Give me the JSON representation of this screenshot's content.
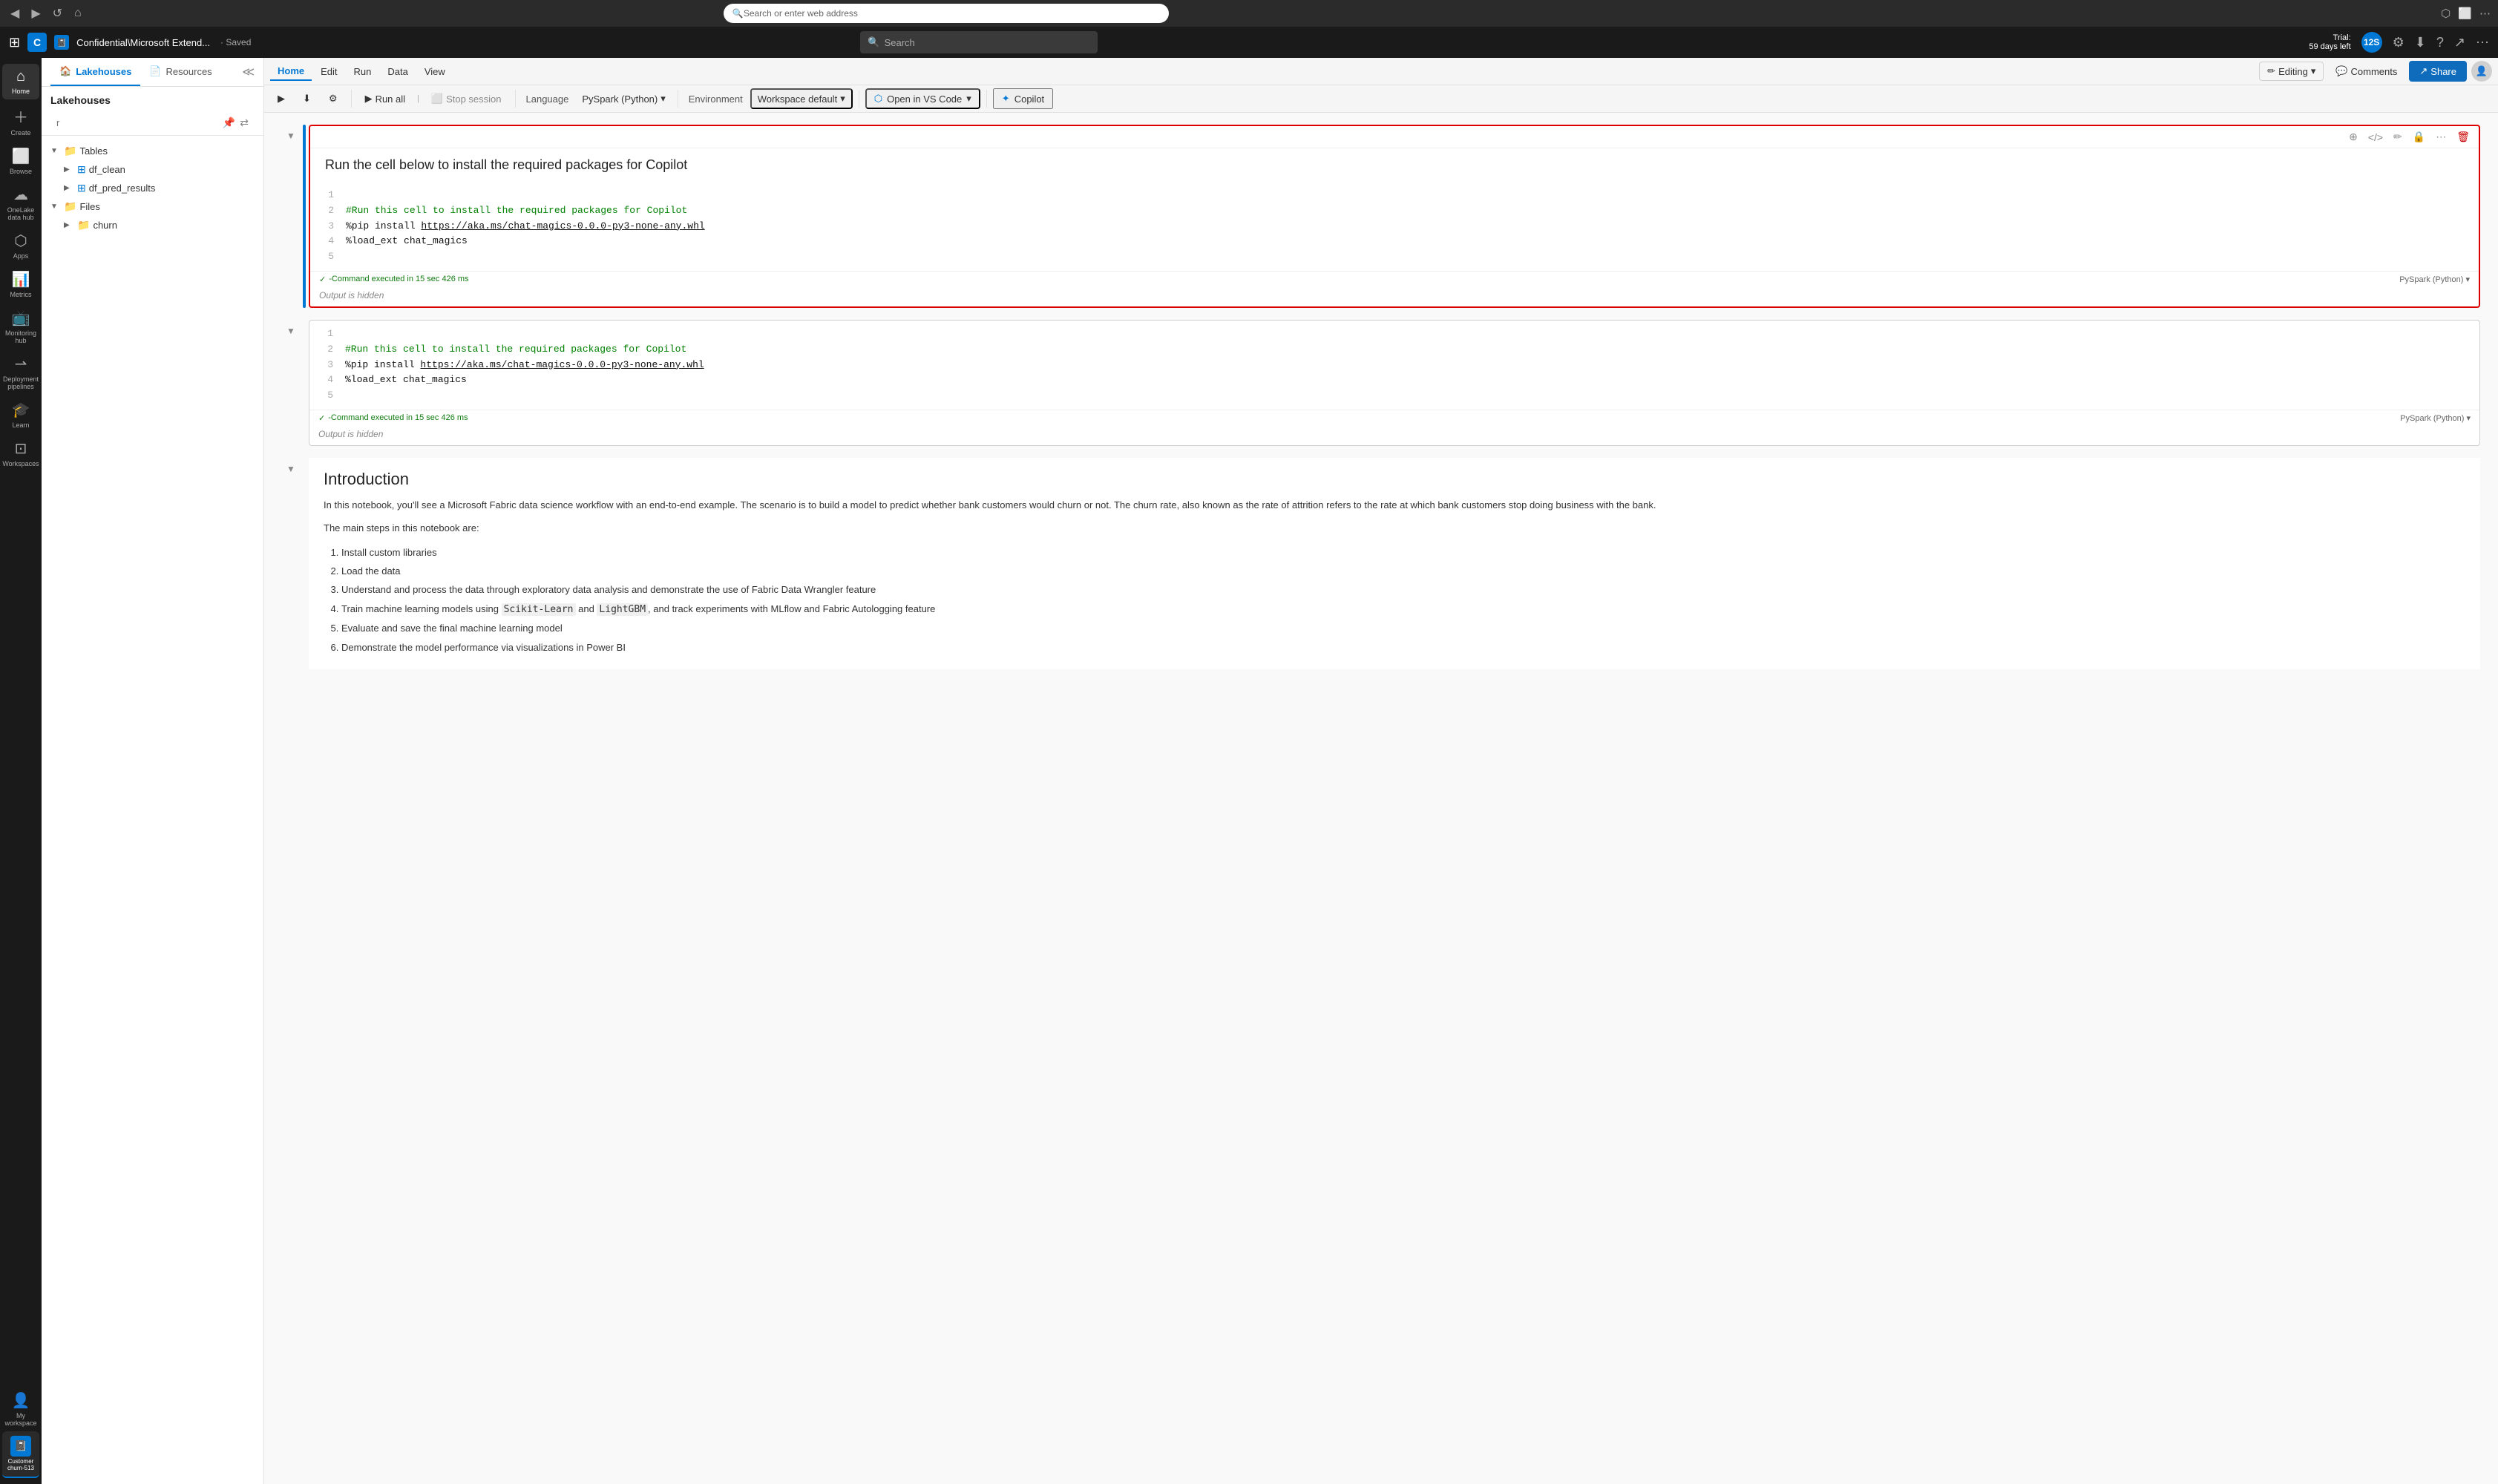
{
  "browser": {
    "address": "Search or enter web address",
    "nav_back": "◀",
    "nav_forward": "▶",
    "nav_refresh": "↺",
    "nav_home": "⌂"
  },
  "titlebar": {
    "app_letter": "C",
    "app_file_icon": "📓",
    "app_name": "Confidential\\Microsoft Extend...",
    "saved_label": "· Saved",
    "search_placeholder": "Search",
    "trial_line1": "Trial:",
    "trial_line2": "59 days left",
    "user_initials": "12S"
  },
  "sidebar": {
    "items": [
      {
        "id": "home",
        "label": "Home",
        "icon": "⌂"
      },
      {
        "id": "create",
        "label": "Create",
        "icon": "+"
      },
      {
        "id": "browse",
        "label": "Browse",
        "icon": "⊞"
      },
      {
        "id": "onelake",
        "label": "OneLake\ndata hub",
        "icon": "☁"
      },
      {
        "id": "apps",
        "label": "Apps",
        "icon": "⬡"
      },
      {
        "id": "metrics",
        "label": "Metrics",
        "icon": "📊"
      },
      {
        "id": "monitoring",
        "label": "Monitoring\nhub",
        "icon": "📺"
      },
      {
        "id": "deployment",
        "label": "Deployment\npipelines",
        "icon": "⇀"
      },
      {
        "id": "learn",
        "label": "Learn",
        "icon": "🎓"
      },
      {
        "id": "workspaces",
        "label": "Workspaces",
        "icon": "⊡"
      }
    ],
    "bottom": {
      "workspace_label": "My\nworkspace",
      "customer_label": "Customer\nchurn-513"
    }
  },
  "left_panel": {
    "tabs": [
      {
        "id": "lakehouses",
        "label": "Lakehouses",
        "icon": "🏠",
        "active": true
      },
      {
        "id": "resources",
        "label": "Resources",
        "icon": "📄"
      }
    ],
    "header": "Lakehouses",
    "tree": [
      {
        "type": "folder",
        "label": "Tables",
        "level": 0,
        "expanded": true
      },
      {
        "type": "table",
        "label": "df_clean",
        "level": 1
      },
      {
        "type": "table",
        "label": "df_pred_results",
        "level": 1
      },
      {
        "type": "folder",
        "label": "Files",
        "level": 0,
        "expanded": true
      },
      {
        "type": "folder",
        "label": "churn",
        "level": 1
      }
    ]
  },
  "menu": {
    "items": [
      {
        "id": "home",
        "label": "Home",
        "active": true
      },
      {
        "id": "edit",
        "label": "Edit"
      },
      {
        "id": "run",
        "label": "Run"
      },
      {
        "id": "data",
        "label": "Data"
      },
      {
        "id": "view",
        "label": "View"
      }
    ]
  },
  "notebook_toolbar": {
    "run_all_label": "Run all",
    "stop_session_label": "Stop session",
    "language_label": "Language",
    "language_value": "PySpark (Python)",
    "environment_label": "Environment",
    "environment_value": "Workspace default",
    "open_vscode_label": "Open in VS Code",
    "copilot_label": "Copilot",
    "editing_label": "Editing",
    "comments_label": "Comments",
    "share_label": "Share"
  },
  "cells": [
    {
      "id": "cell-1",
      "type": "code",
      "active": true,
      "header_text": "Run the cell below to install the required packages for Copilot",
      "lines": [
        {
          "num": "1",
          "content": "",
          "type": "plain"
        },
        {
          "num": "2",
          "content": "#Run this cell to install the required packages for Copilot",
          "type": "comment"
        },
        {
          "num": "3",
          "content": "%pip install https://aka.ms/chat-magics-0.0.0-py3-none-any.whl",
          "type": "cmd"
        },
        {
          "num": "4",
          "content": "%load_ext chat_magics",
          "type": "cmd"
        },
        {
          "num": "5",
          "content": "",
          "type": "plain"
        }
      ],
      "status": "-Command executed in 15 sec 426 ms",
      "lang": "PySpark (Python)",
      "output": "Output is hidden"
    },
    {
      "id": "cell-2",
      "type": "code",
      "active": false,
      "lines": [
        {
          "num": "1",
          "content": "",
          "type": "plain"
        },
        {
          "num": "2",
          "content": "#Run this cell to install the required packages for Copilot",
          "type": "comment"
        },
        {
          "num": "3",
          "content": "%pip install https://aka.ms/chat-magics-0.0.0-py3-none-any.whl",
          "type": "cmd"
        },
        {
          "num": "4",
          "content": "%load_ext chat_magics",
          "type": "cmd"
        },
        {
          "num": "5",
          "content": "",
          "type": "plain"
        }
      ],
      "status": "-Command executed in 15 sec 426 ms",
      "lang": "PySpark (Python)",
      "output": "Output is hidden"
    }
  ],
  "intro": {
    "title": "Introduction",
    "paragraph1": "In this notebook, you'll see a Microsoft Fabric data science workflow with an end-to-end example. The scenario is to build a model to predict whether bank customers would churn or not. The churn rate, also known as the rate of attrition refers to the rate at which bank customers stop doing business with the bank.",
    "paragraph2": "The main steps in this notebook are:",
    "list": [
      "Install custom libraries",
      "Load the data",
      "Understand and process the data through exploratory data analysis and demonstrate the use of Fabric Data Wrangler feature",
      "Train machine learning models using Scikit-Learn and LightGBM, and track experiments with MLflow and Fabric Autologging feature",
      "Evaluate and save the final machine learning model",
      "Demonstrate the model performance via visualizations in Power BI"
    ]
  }
}
